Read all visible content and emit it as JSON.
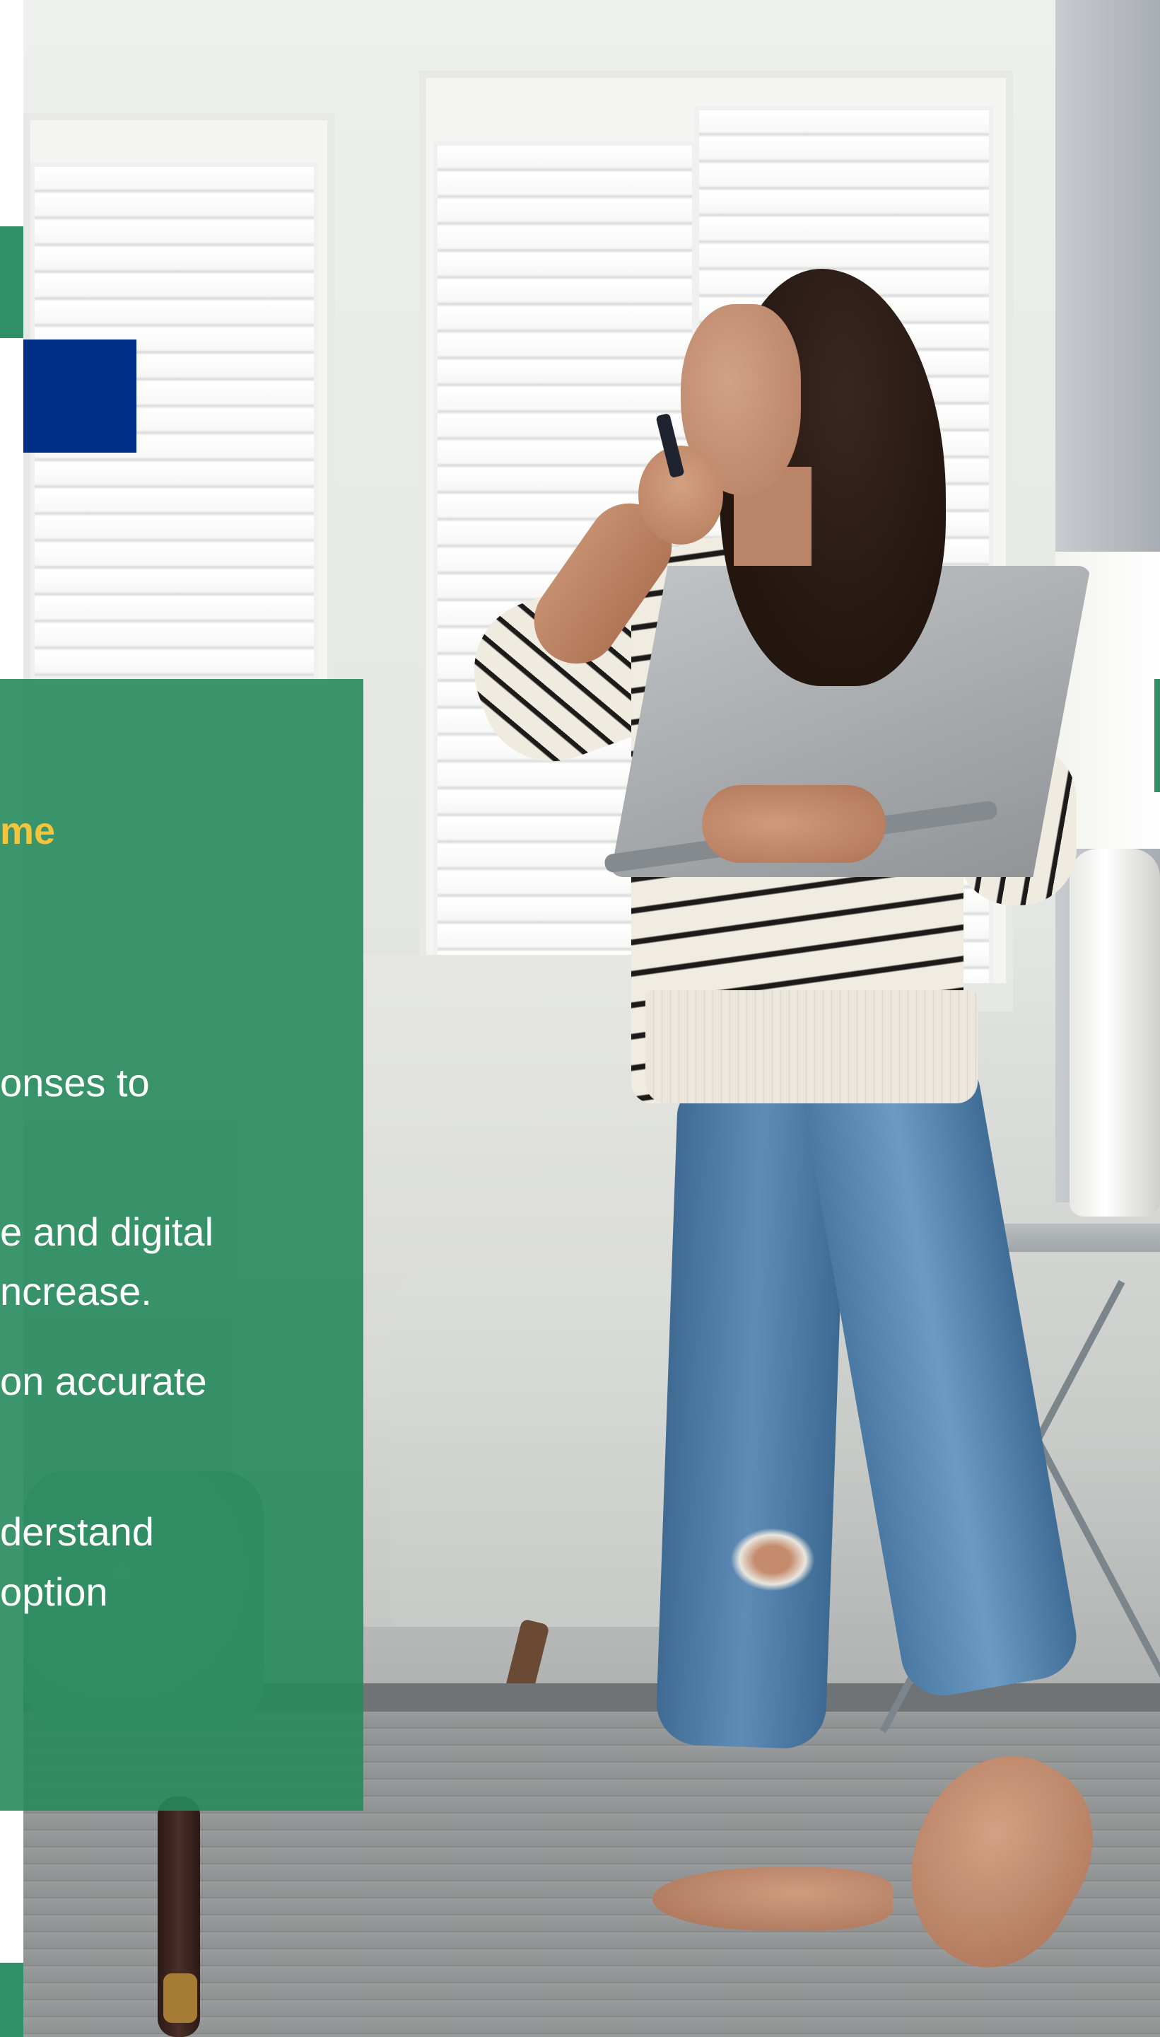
{
  "panel": {
    "heading": "me",
    "lines": [
      "onses to",
      "e and digital",
      "ncrease.",
      "on accurate",
      "derstand",
      "option"
    ]
  },
  "colors": {
    "panel_green": "#2f8f66",
    "brand_blue": "#002f87",
    "heading_yellow": "#f5c43d"
  },
  "photo": {
    "subject": "woman-on-phone-holding-laptop-icon"
  }
}
